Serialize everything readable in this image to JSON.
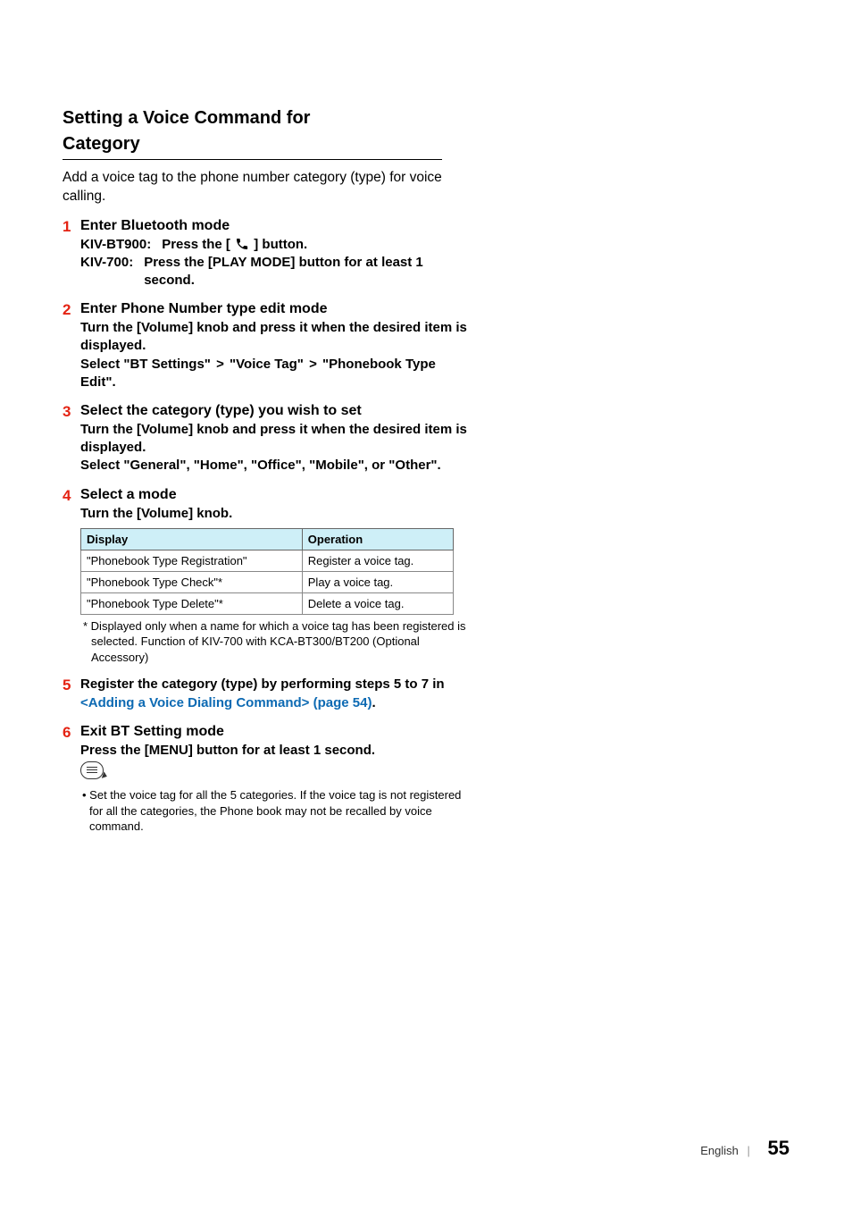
{
  "section": {
    "title_line1": "Setting a Voice Command for",
    "title_line2": "Category",
    "intro": "Add a voice tag to the phone number category (type) for voice calling."
  },
  "steps": {
    "s1": {
      "num": "1",
      "head": "Enter Bluetooth mode",
      "kv1_label": "KIV-BT900:",
      "kv1_text_a": "Press the [",
      "kv1_text_b": "] button.",
      "kv2_label": "KIV-700:",
      "kv2_text": "Press the [PLAY MODE] button for at least 1 second."
    },
    "s2": {
      "num": "2",
      "head": "Enter Phone Number type edit mode",
      "body1": "Turn the [Volume] knob and press it when the desired item is displayed.",
      "body2a": "Select \"BT Settings\"",
      "body2b": "\"Voice Tag\"",
      "body2c": "\"Phonebook Type Edit\"."
    },
    "s3": {
      "num": "3",
      "head": "Select the category (type) you wish to set",
      "body1": "Turn the [Volume] knob and press it when the desired item is displayed.",
      "body2": "Select \"General\", \"Home\", \"Office\", \"Mobile\", or \"Other\"."
    },
    "s4": {
      "num": "4",
      "head": "Select a mode",
      "body1": "Turn the [Volume] knob.",
      "table": {
        "h1": "Display",
        "h2": "Operation",
        "r1c1": "\"Phonebook Type Registration\"",
        "r1c2": "Register a voice tag.",
        "r2c1": "\"Phonebook Type Check\"*",
        "r2c2": "Play a voice tag.",
        "r3c1": "\"Phonebook Type Delete\"*",
        "r3c2": "Delete a voice tag."
      },
      "footnote": "*  Displayed only when a name for which a voice tag has been registered is selected. Function of KIV-700 with KCA-BT300/BT200 (Optional Accessory)"
    },
    "s5": {
      "num": "5",
      "body_a": "Register the category (type) by performing steps 5 to 7 in ",
      "link": "<Adding a Voice Dialing Command> (page 54)",
      "body_b": "."
    },
    "s6": {
      "num": "6",
      "head": "Exit BT Setting mode",
      "body1": "Press the [MENU] button for at least 1 second.",
      "note": "•  Set the voice tag for all the 5 categories.  If the voice tag is not registered for all the categories, the Phone book may not be recalled by voice command."
    }
  },
  "footer": {
    "lang": "English",
    "sep": "|",
    "page": "55"
  }
}
